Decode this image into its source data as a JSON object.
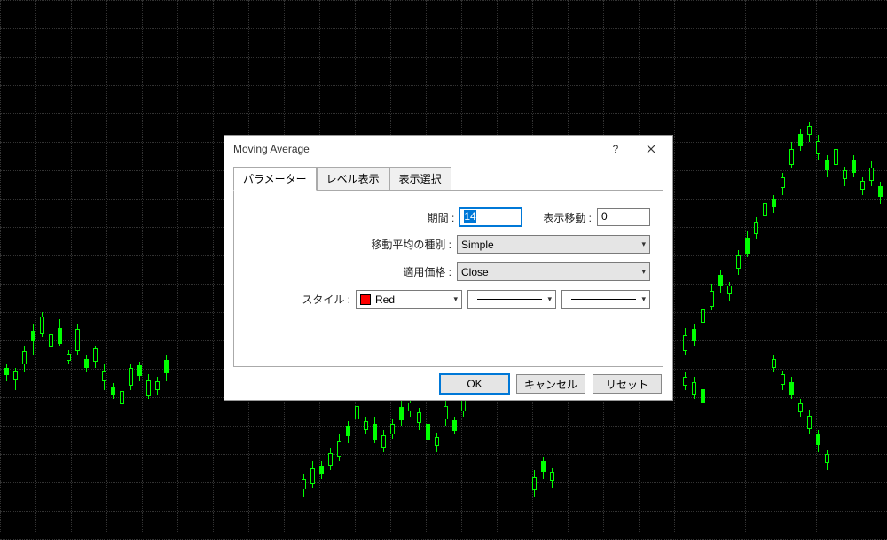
{
  "dialog": {
    "title": "Moving Average",
    "tabs": {
      "parameters": "パラメーター",
      "levels": "レベル表示",
      "display": "表示選択"
    },
    "labels": {
      "period": "期間 :",
      "shift": "表示移動 :",
      "method": "移動平均の種別 :",
      "apply": "適用価格 :",
      "style": "スタイル :"
    },
    "values": {
      "period": "14",
      "shift": "0",
      "method": "Simple",
      "apply": "Close",
      "color": "Red",
      "color_hex": "#ff0000"
    },
    "buttons": {
      "ok": "OK",
      "cancel": "キャンセル",
      "reset": "リセット"
    }
  }
}
